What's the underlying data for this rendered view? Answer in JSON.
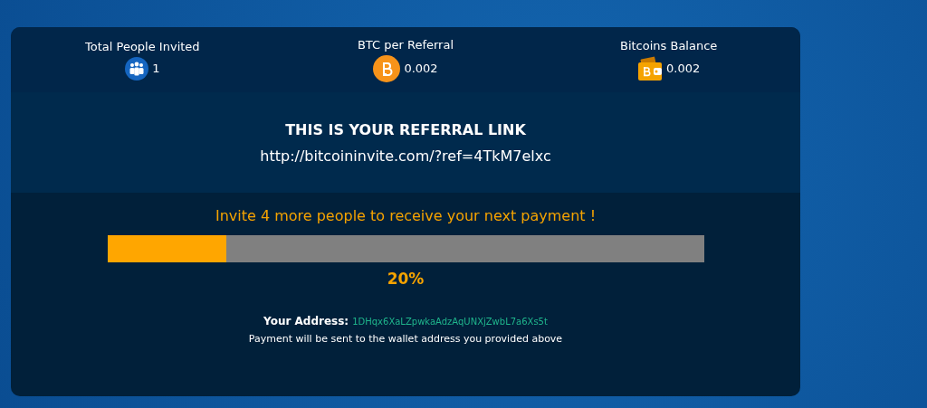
{
  "stats": [
    {
      "kind": "people",
      "label": "Total People Invited",
      "value": "1"
    },
    {
      "kind": "coin",
      "label": "BTC per Referral",
      "value": "0.002"
    },
    {
      "kind": "wallet",
      "label": "Bitcoins Balance",
      "value": "0.002"
    }
  ],
  "referral": {
    "title": "THIS IS YOUR REFERRAL LINK",
    "link": "http://bitcoininvite.com/?ref=4TkM7elxc"
  },
  "progress": {
    "message": "Invite 4 more people to receive your next payment !",
    "level": 0.2,
    "reading": "20%"
  },
  "address": {
    "label": "Your Address:",
    "value": "1DHqx6XaLZpwkaAdzAqUNXjZwbL7a6Xs5t",
    "note": "Payment will be sent to the wallet address you provided above"
  }
}
